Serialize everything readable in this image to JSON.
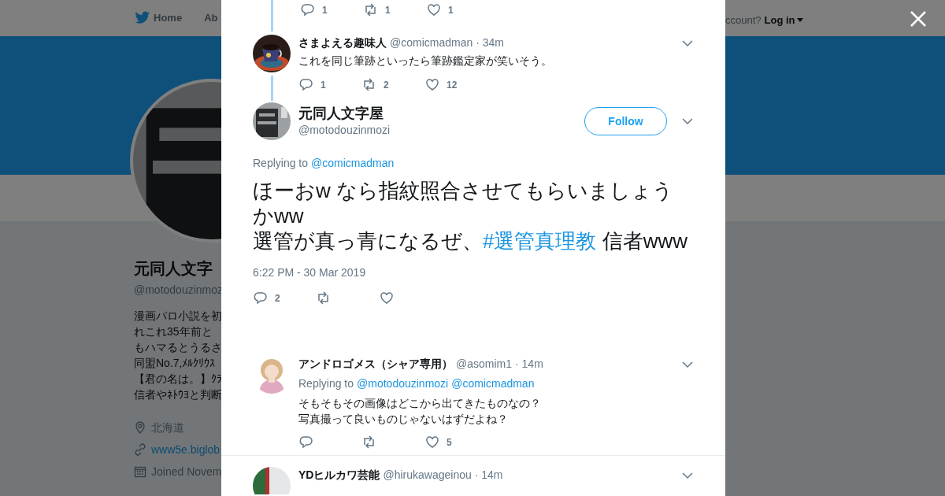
{
  "background_page": {
    "nav_items": [
      {
        "label": "Home",
        "kind": "home"
      },
      {
        "label": "Ab",
        "kind": "plain"
      }
    ],
    "login_prompt": "ccount?",
    "login_button": "Log in",
    "profile": {
      "name": "元同人文字",
      "handle": "@motodouzinmoz",
      "bio_lines": [
        "漫画パロ小説を初",
        "れこれ35年前と",
        "もハマるとうるさ",
        "同盟No.7,ﾒﾙｸﾘｳｽ",
        "【君の名は。】ｸﾗ",
        "信者やﾈﾄｳﾖと判断"
      ],
      "location": "北海道",
      "website": "www5e.biglob",
      "joined": "Joined Novem"
    }
  },
  "modal": {
    "previous_tweet_actions": {
      "replies": "1",
      "retweets": "1",
      "likes": "1"
    },
    "parent_tweet": {
      "name": "さまよえる趣味人",
      "handle": "@comicmadman",
      "time": "· 34m",
      "text": "これを同じ筆跡といったら筆跡鑑定家が笑いそう。",
      "actions": {
        "replies": "1",
        "retweets": "2",
        "likes": "12"
      }
    },
    "main_tweet": {
      "name": "元同人文字屋",
      "handle": "@motodouzinmozi",
      "follow_button": "Follow",
      "replying_label": "Replying to",
      "replying_to": [
        "@comicmadman"
      ],
      "text_parts": [
        {
          "kind": "text",
          "text": "ほーおw なら指紋照合させてもらいましょうかww\n選管が真っ青になるぜ、"
        },
        {
          "kind": "hashtag",
          "text": "#選管真理教"
        },
        {
          "kind": "text",
          "text": " 信者www"
        }
      ],
      "timestamp": "6:22 PM - 30 Mar 2019",
      "actions": {
        "replies": "2"
      }
    },
    "replies": [
      {
        "name": "アンドロゴメス（シャア専用）",
        "handle": "@asomim1",
        "time": "· 14m",
        "replying_label": "Replying to",
        "replying_to": [
          "@motodouzinmozi",
          "@comicmadman"
        ],
        "text_lines": [
          "そもそもその画像はどこから出てきたものなの？",
          "写真撮って良いものじゃないはずだよね？"
        ],
        "actions": {
          "likes": "5"
        }
      },
      {
        "name": "YDヒルカワ芸能",
        "handle": "@hirukawageinou",
        "time": "· 14m"
      }
    ]
  }
}
